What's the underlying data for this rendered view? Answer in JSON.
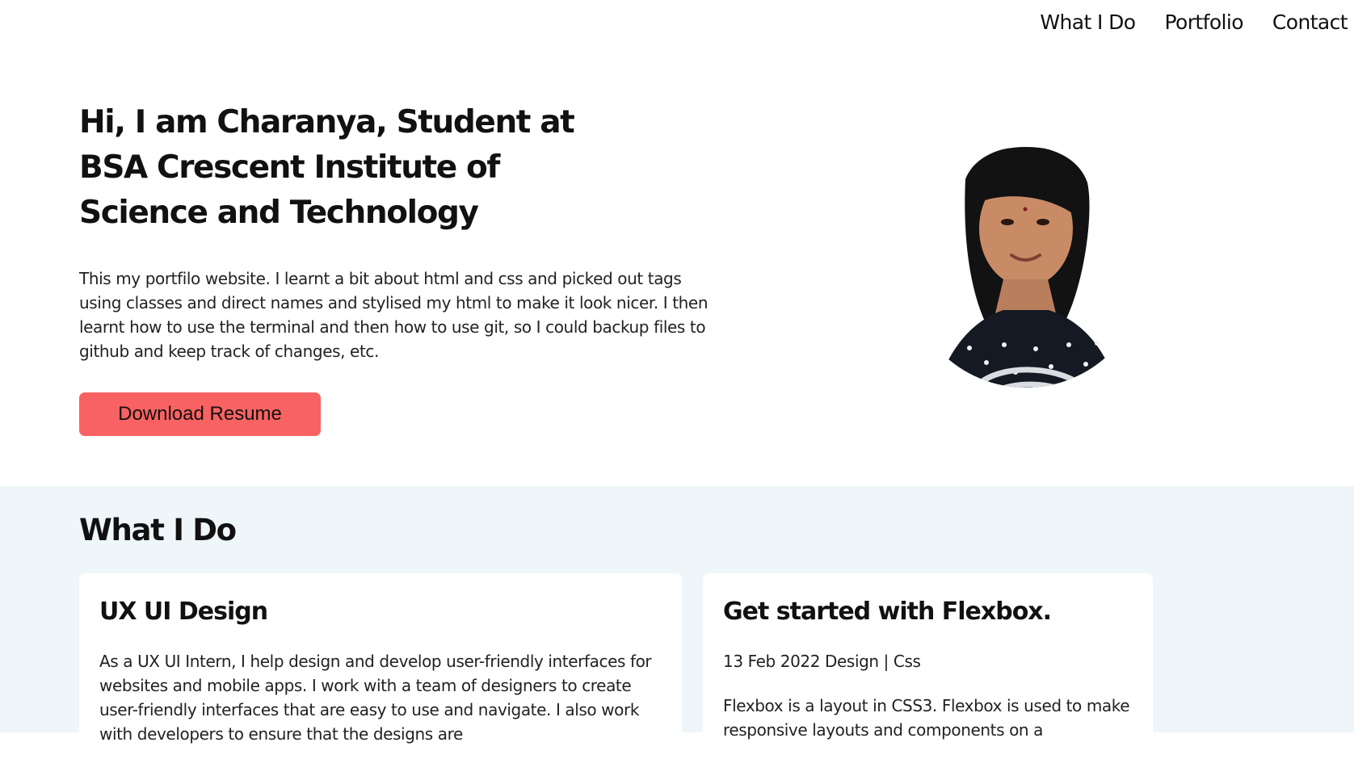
{
  "nav": {
    "items": [
      {
        "label": "What I Do"
      },
      {
        "label": "Portfolio"
      },
      {
        "label": "Contact"
      }
    ]
  },
  "hero": {
    "title": "Hi, I am Charanya, Student at BSA Crescent Institute of Science and Technology",
    "description": "This my portfilo website. I learnt a bit about html and css and picked out tags using classes and direct names and stylised my html to make it look nicer. I then learnt how to use the terminal and then how to use git, so I could backup files to github and keep track of changes, etc.",
    "button_label": "Download Resume"
  },
  "what_i_do": {
    "title": "What I Do",
    "cards": [
      {
        "title": "UX UI Design",
        "text": "As a UX UI Intern, I help design and develop user-friendly interfaces for websites and mobile apps. I work with a team of designers to create user-friendly interfaces that are easy to use and navigate. I also work with developers to ensure that the designs are"
      },
      {
        "title": "Get started with Flexbox.",
        "meta": "13 Feb 2022 Design | Css",
        "text": "Flexbox is a layout in CSS3. Flexbox is used to make responsive layouts and components on a"
      }
    ]
  },
  "colors": {
    "accent": "#f96262",
    "section_background": "#eef6f9",
    "card_background": "#ffffff",
    "text": "#111111"
  }
}
